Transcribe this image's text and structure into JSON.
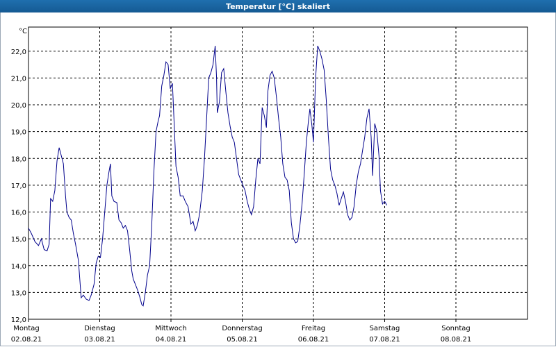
{
  "window": {
    "title": "Temperatur [°C] skaliert"
  },
  "chart_data": {
    "type": "line",
    "title": "Temperatur [°C] skaliert",
    "ylabel": "°C",
    "ylim": [
      12.0,
      22.9
    ],
    "yticks": [
      12.0,
      13.0,
      14.0,
      15.0,
      16.0,
      17.0,
      18.0,
      19.0,
      20.0,
      21.0,
      22.0
    ],
    "xlim": [
      0,
      7
    ],
    "grid": true,
    "x_ticks": [
      {
        "day": "Montag",
        "date": "02.08.21",
        "x": 0
      },
      {
        "day": "Dienstag",
        "date": "03.08.21",
        "x": 1
      },
      {
        "day": "Mittwoch",
        "date": "04.08.21",
        "x": 2
      },
      {
        "day": "Donnerstag",
        "date": "05.08.21",
        "x": 3
      },
      {
        "day": "Freitag",
        "date": "06.08.21",
        "x": 4
      },
      {
        "day": "Samstag",
        "date": "07.08.21",
        "x": 5
      },
      {
        "day": "Sonntag",
        "date": "08.08.21",
        "x": 6
      }
    ],
    "series": [
      {
        "color": "#00008b",
        "points": [
          [
            0.0,
            15.4
          ],
          [
            0.04,
            15.2
          ],
          [
            0.09,
            14.9
          ],
          [
            0.14,
            14.75
          ],
          [
            0.18,
            15.0
          ],
          [
            0.22,
            14.6
          ],
          [
            0.26,
            14.55
          ],
          [
            0.29,
            14.8
          ],
          [
            0.31,
            16.5
          ],
          [
            0.34,
            16.4
          ],
          [
            0.37,
            16.8
          ],
          [
            0.4,
            17.9
          ],
          [
            0.43,
            18.4
          ],
          [
            0.46,
            18.1
          ],
          [
            0.49,
            17.8
          ],
          [
            0.52,
            16.6
          ],
          [
            0.54,
            16.0
          ],
          [
            0.57,
            15.8
          ],
          [
            0.6,
            15.7
          ],
          [
            0.63,
            15.2
          ],
          [
            0.66,
            14.8
          ],
          [
            0.7,
            14.2
          ],
          [
            0.72,
            13.5
          ],
          [
            0.74,
            12.8
          ],
          [
            0.77,
            12.9
          ],
          [
            0.81,
            12.75
          ],
          [
            0.85,
            12.7
          ],
          [
            0.88,
            12.9
          ],
          [
            0.92,
            13.3
          ],
          [
            0.95,
            14.1
          ],
          [
            0.98,
            14.35
          ],
          [
            1.01,
            14.3
          ],
          [
            1.04,
            15.0
          ],
          [
            1.07,
            16.0
          ],
          [
            1.1,
            17.0
          ],
          [
            1.13,
            17.5
          ],
          [
            1.15,
            17.8
          ],
          [
            1.17,
            16.6
          ],
          [
            1.2,
            16.4
          ],
          [
            1.24,
            16.35
          ],
          [
            1.27,
            15.7
          ],
          [
            1.3,
            15.6
          ],
          [
            1.33,
            15.4
          ],
          [
            1.36,
            15.5
          ],
          [
            1.39,
            15.3
          ],
          [
            1.42,
            14.6
          ],
          [
            1.45,
            13.8
          ],
          [
            1.47,
            13.5
          ],
          [
            1.5,
            13.3
          ],
          [
            1.53,
            13.1
          ],
          [
            1.56,
            12.85
          ],
          [
            1.59,
            12.55
          ],
          [
            1.61,
            12.5
          ],
          [
            1.64,
            13.0
          ],
          [
            1.67,
            13.65
          ],
          [
            1.7,
            14.0
          ],
          [
            1.73,
            15.5
          ],
          [
            1.76,
            17.5
          ],
          [
            1.79,
            19.0
          ],
          [
            1.82,
            19.4
          ],
          [
            1.84,
            19.6
          ],
          [
            1.87,
            20.7
          ],
          [
            1.9,
            21.1
          ],
          [
            1.93,
            21.6
          ],
          [
            1.96,
            21.5
          ],
          [
            1.99,
            20.6
          ],
          [
            2.02,
            20.8
          ],
          [
            2.04,
            19.6
          ],
          [
            2.07,
            17.7
          ],
          [
            2.1,
            17.3
          ],
          [
            2.13,
            16.6
          ],
          [
            2.17,
            16.6
          ],
          [
            2.2,
            16.4
          ],
          [
            2.24,
            16.2
          ],
          [
            2.28,
            15.55
          ],
          [
            2.31,
            15.65
          ],
          [
            2.34,
            15.3
          ],
          [
            2.37,
            15.5
          ],
          [
            2.4,
            15.9
          ],
          [
            2.44,
            16.8
          ],
          [
            2.47,
            18.0
          ],
          [
            2.5,
            19.5
          ],
          [
            2.53,
            21.0
          ],
          [
            2.56,
            21.2
          ],
          [
            2.59,
            21.5
          ],
          [
            2.62,
            22.2
          ],
          [
            2.64,
            21.0
          ],
          [
            2.65,
            19.7
          ],
          [
            2.68,
            20.1
          ],
          [
            2.71,
            21.2
          ],
          [
            2.74,
            21.35
          ],
          [
            2.77,
            20.5
          ],
          [
            2.8,
            19.7
          ],
          [
            2.83,
            19.2
          ],
          [
            2.86,
            18.8
          ],
          [
            2.89,
            18.6
          ],
          [
            2.92,
            18.0
          ],
          [
            2.95,
            17.4
          ],
          [
            2.98,
            17.2
          ],
          [
            3.01,
            17.0
          ],
          [
            3.04,
            16.8
          ],
          [
            3.07,
            16.4
          ],
          [
            3.1,
            16.1
          ],
          [
            3.13,
            15.9
          ],
          [
            3.16,
            16.2
          ],
          [
            3.19,
            17.2
          ],
          [
            3.22,
            18.0
          ],
          [
            3.25,
            17.8
          ],
          [
            3.28,
            19.9
          ],
          [
            3.31,
            19.6
          ],
          [
            3.34,
            19.15
          ],
          [
            3.36,
            20.5
          ],
          [
            3.39,
            21.1
          ],
          [
            3.42,
            21.25
          ],
          [
            3.45,
            21.0
          ],
          [
            3.48,
            20.3
          ],
          [
            3.51,
            19.5
          ],
          [
            3.54,
            18.8
          ],
          [
            3.57,
            17.8
          ],
          [
            3.6,
            17.3
          ],
          [
            3.63,
            17.2
          ],
          [
            3.66,
            16.8
          ],
          [
            3.69,
            15.6
          ],
          [
            3.72,
            15.0
          ],
          [
            3.75,
            14.85
          ],
          [
            3.78,
            14.9
          ],
          [
            3.81,
            15.5
          ],
          [
            3.84,
            16.3
          ],
          [
            3.87,
            17.4
          ],
          [
            3.9,
            18.6
          ],
          [
            3.93,
            19.4
          ],
          [
            3.95,
            19.85
          ],
          [
            3.98,
            19.2
          ],
          [
            4.0,
            18.6
          ],
          [
            4.03,
            21.0
          ],
          [
            4.06,
            22.2
          ],
          [
            4.09,
            22.0
          ],
          [
            4.12,
            21.7
          ],
          [
            4.15,
            21.3
          ],
          [
            4.18,
            20.2
          ],
          [
            4.21,
            18.8
          ],
          [
            4.24,
            17.6
          ],
          [
            4.27,
            17.2
          ],
          [
            4.3,
            17.0
          ],
          [
            4.33,
            16.7
          ],
          [
            4.36,
            16.25
          ],
          [
            4.39,
            16.5
          ],
          [
            4.42,
            16.75
          ],
          [
            4.45,
            16.4
          ],
          [
            4.48,
            15.9
          ],
          [
            4.51,
            15.7
          ],
          [
            4.54,
            15.8
          ],
          [
            4.57,
            16.2
          ],
          [
            4.6,
            17.0
          ],
          [
            4.63,
            17.5
          ],
          [
            4.66,
            17.8
          ],
          [
            4.69,
            18.3
          ],
          [
            4.72,
            18.8
          ],
          [
            4.75,
            19.5
          ],
          [
            4.78,
            19.85
          ],
          [
            4.81,
            18.8
          ],
          [
            4.83,
            17.35
          ],
          [
            4.86,
            19.3
          ],
          [
            4.89,
            19.0
          ],
          [
            4.92,
            18.1
          ],
          [
            4.94,
            16.8
          ],
          [
            4.97,
            16.3
          ],
          [
            5.0,
            16.4
          ],
          [
            5.03,
            16.25
          ]
        ]
      }
    ]
  }
}
